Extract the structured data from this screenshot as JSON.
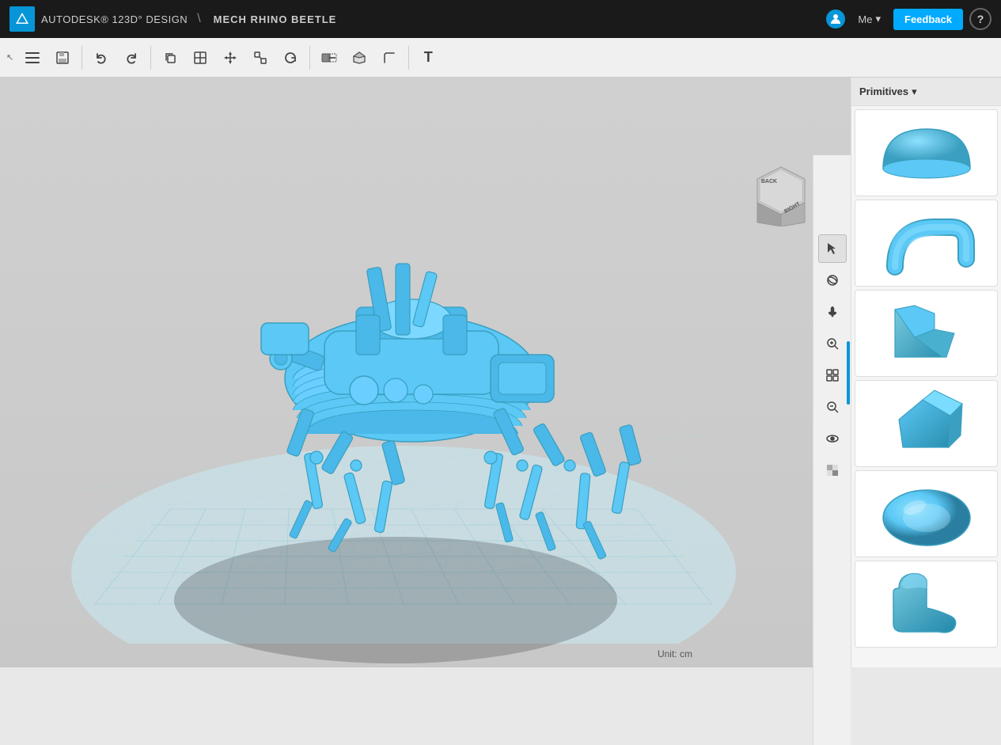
{
  "header": {
    "app_name": "AUTODESK® 123D° DESIGN",
    "separator": "\\",
    "project_name": "MECH RHINO BEETLE",
    "me_label": "Me",
    "feedback_label": "Feedback",
    "help_label": "?"
  },
  "toolbar": {
    "buttons": [
      {
        "name": "menu-button",
        "icon": "☰",
        "label": "Menu"
      },
      {
        "name": "save-button",
        "icon": "💾",
        "label": "Save"
      },
      {
        "name": "undo-button",
        "icon": "↩",
        "label": "Undo"
      },
      {
        "name": "redo-button",
        "icon": "↪",
        "label": "Redo"
      },
      {
        "name": "copy-button",
        "icon": "⬜",
        "label": "Copy"
      },
      {
        "name": "grid-button",
        "icon": "⊞",
        "label": "Grid"
      },
      {
        "name": "transform-button",
        "icon": "✛",
        "label": "Transform"
      },
      {
        "name": "scale-button",
        "icon": "⊡",
        "label": "Scale"
      },
      {
        "name": "rotate-button",
        "icon": "↻",
        "label": "Rotate"
      },
      {
        "name": "combine-button",
        "icon": "⊕",
        "label": "Combine"
      },
      {
        "name": "extrude-button",
        "icon": "⬡",
        "label": "Extrude"
      },
      {
        "name": "filet-button",
        "icon": "◈",
        "label": "Fillet"
      },
      {
        "name": "text-button",
        "icon": "T",
        "label": "Text"
      }
    ]
  },
  "view_tools": [
    {
      "name": "select-tool",
      "icon": "↖",
      "label": "Select"
    },
    {
      "name": "orbit-tool",
      "icon": "◎",
      "label": "Orbit"
    },
    {
      "name": "pan-tool",
      "icon": "✋",
      "label": "Pan"
    },
    {
      "name": "zoom-tool",
      "icon": "🔍",
      "label": "Zoom"
    },
    {
      "name": "fit-tool",
      "icon": "⊞",
      "label": "Fit"
    },
    {
      "name": "zoom-in-tool",
      "icon": "⊕",
      "label": "Zoom In"
    },
    {
      "name": "view-mode-tool",
      "icon": "👁",
      "label": "View Mode"
    },
    {
      "name": "material-tool",
      "icon": "◧",
      "label": "Material"
    }
  ],
  "view_cube": {
    "labels": {
      "right": "RIGHT",
      "back": "BACK"
    }
  },
  "right_panel": {
    "title": "Primitives",
    "dropdown_arrow": "▾",
    "primitives": [
      {
        "name": "half-sphere",
        "color": "#5bc8f5"
      },
      {
        "name": "curved-pipe",
        "color": "#5bc8f5"
      },
      {
        "name": "l-bracket",
        "color": "#5ab4e0"
      },
      {
        "name": "pentagon-prism",
        "color": "#4aa8d8"
      },
      {
        "name": "oval",
        "color": "#5bc8f5"
      },
      {
        "name": "foot-shape",
        "color": "#5bc8f5"
      }
    ]
  },
  "viewport": {
    "unit_label": "Unit:",
    "unit_value": "cm"
  }
}
